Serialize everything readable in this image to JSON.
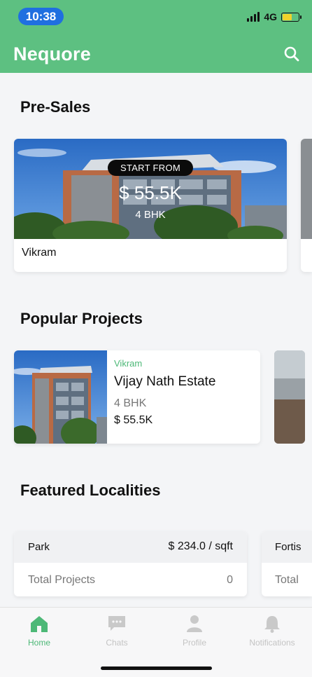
{
  "status": {
    "time": "10:38",
    "network": "4G"
  },
  "header": {
    "title": "Nequore"
  },
  "sections": {
    "presales_title": "Pre-Sales",
    "popular_title": "Popular Projects",
    "localities_title": "Featured Localities"
  },
  "presale": {
    "badge": "START FROM",
    "price": "$ 55.5K",
    "bhk": "4 BHK",
    "name": "Vikram"
  },
  "project": {
    "locality": "Vikram",
    "name": "Vijay Nath Estate",
    "bhk": "4 BHK",
    "price": "$ 55.5K"
  },
  "locality": {
    "name": "Park",
    "rate": "$ 234.0 / sqft",
    "label": "Total Projects",
    "count": "0"
  },
  "locality_peek": {
    "name": "Fortis",
    "label": "Total"
  },
  "nav": {
    "home": "Home",
    "chats": "Chats",
    "profile": "Profile",
    "notifications": "Notifications"
  },
  "colors": {
    "brand": "#5dc081",
    "accent_text": "#4db877",
    "time_pill": "#1f6fe0"
  }
}
